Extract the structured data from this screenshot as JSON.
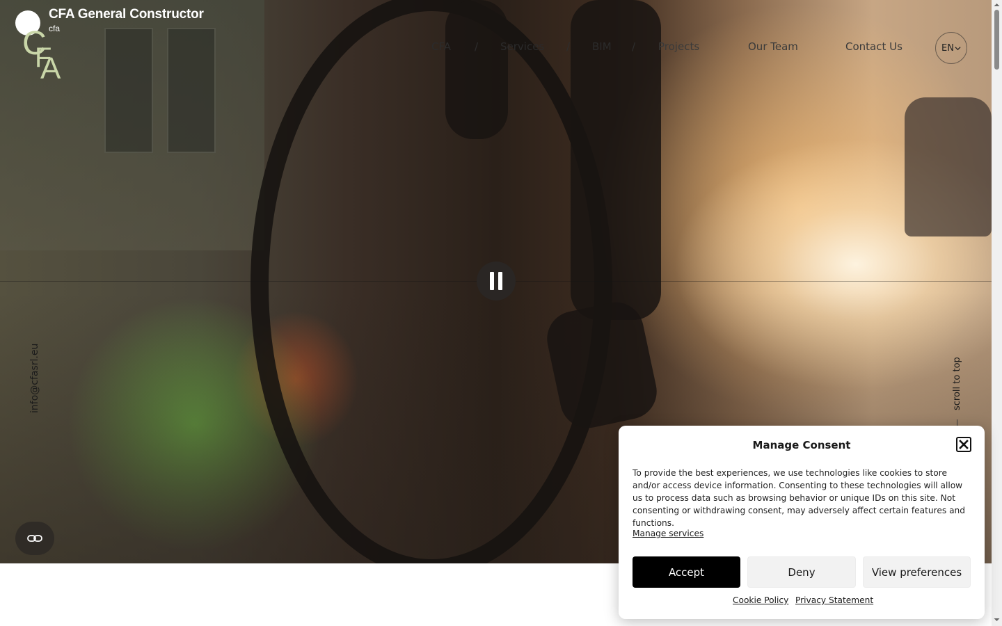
{
  "header": {
    "site_title": "CFA General Constructor",
    "tagline": "cfa",
    "logo_letters": "CFA"
  },
  "nav": {
    "items": [
      {
        "label": "CFA"
      },
      {
        "label": "Services"
      },
      {
        "label": "BIM"
      },
      {
        "label": "Projects"
      },
      {
        "label": "Our Team"
      },
      {
        "label": "Contact Us"
      }
    ],
    "separator": "/"
  },
  "language": {
    "current": "EN",
    "icon": "chevron-down-icon"
  },
  "side": {
    "email": "info@cfasrl.eu",
    "scroll_to_top": "scroll to top"
  },
  "video": {
    "state_icon": "pause-icon"
  },
  "floating": {
    "icon": "link-icon"
  },
  "consent": {
    "title": "Manage Consent",
    "body": "To provide the best experiences, we use technologies like cookies to store and/or access device information. Consenting to these technologies will allow us to process data such as browsing behavior or unique IDs on this site. Not consenting or withdrawing consent, may adversely affect certain features and functions.",
    "manage_services": "Manage services",
    "accept": "Accept",
    "deny": "Deny",
    "view_preferences": "View preferences",
    "cookie_policy": "Cookie Policy",
    "privacy_statement": "Privacy Statement"
  },
  "colors": {
    "accept_bg": "#000000",
    "secondary_bg": "#f2f2f2",
    "logo_color": "#c9d6a8"
  }
}
